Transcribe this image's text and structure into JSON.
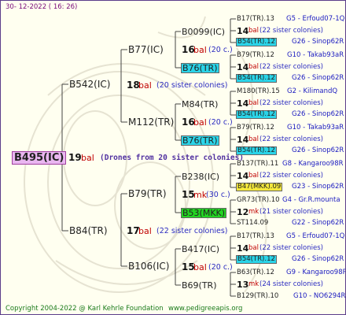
{
  "header": {
    "date": "30- 12-2022 ( 16: 26)"
  },
  "footer": {
    "copyright": "Copyright 2004-2022 @ Karl Kehrle Foundation",
    "site": "www.pedigreeapis.org"
  },
  "root": {
    "id": "B495(IC)",
    "num": "19",
    "bal": "bal",
    "note": "(Drones from 20 sister colonies)"
  },
  "g1": [
    {
      "id": "B542(IC)",
      "num": "18",
      "bal": "bal",
      "note": "(20 sister colonies)"
    },
    {
      "id": "B84(TR)",
      "num": "17",
      "bal": "bal",
      "note": "(22 sister colonies)"
    }
  ],
  "g2": [
    {
      "id": "B77(IC)",
      "num": "16",
      "bal": "bal",
      "note": "(20 c.)"
    },
    {
      "id": "M112(TR)",
      "num": "16",
      "bal": "bal",
      "note": "(20 c.)"
    },
    {
      "id": "B79(TR)",
      "num": "15",
      "bal": "mk",
      "note": "(30 c.)"
    },
    {
      "id": "B106(IC)",
      "num": "15",
      "bal": "bal",
      "note": "(20 c.)"
    }
  ],
  "g3": [
    {
      "id": "B0099(IC)"
    },
    {
      "id": "B76(TR)"
    },
    {
      "id": "M84(TR)"
    },
    {
      "id": "B76(TR)"
    },
    {
      "id": "B238(IC)"
    },
    {
      "id": "B53(MKK)"
    },
    {
      "id": "B417(IC)"
    },
    {
      "id": "B69(TR)"
    }
  ],
  "g4": [
    {
      "id": "B17(TR).13",
      "origin": "G5 - Erfoud07-1Q"
    },
    {
      "num": "14",
      "bal": "bal",
      "note": "(22 sister colonies)"
    },
    {
      "id": "B54(TR).12",
      "origin": "G26 - Sinop62R"
    },
    {
      "id": "B79(TR).12",
      "origin": "G10 - Takab93aR"
    },
    {
      "num": "14",
      "bal": "bal",
      "note": "(22 sister colonies)"
    },
    {
      "id": "B54(TR).12",
      "origin": "G26 - Sinop62R"
    },
    {
      "id": "M180(TR).15",
      "origin": "G2 - KilimandQ"
    },
    {
      "num": "14",
      "bal": "bal",
      "note": "(22 sister colonies)"
    },
    {
      "id": "B54(TR).12",
      "origin": "G26 - Sinop62R"
    },
    {
      "id": "B79(TR).12",
      "origin": "G10 - Takab93aR"
    },
    {
      "num": "14",
      "bal": "bal",
      "note": "(22 sister colonies)"
    },
    {
      "id": "B54(TR).12",
      "origin": "G26 - Sinop62R"
    },
    {
      "id": "B137(TR).11",
      "origin": "G8 - Kangaroo98R"
    },
    {
      "num": "14",
      "bal": "bal",
      "note": "(22 sister colonies)"
    },
    {
      "id": "B47(MKK).09",
      "origin": "G23 - Sinop62R"
    },
    {
      "id": "GR73(TR).10",
      "origin": "G4 - Gr.R.mounta"
    },
    {
      "num": "12",
      "bal": "mk",
      "note": "(21 sister colonies)"
    },
    {
      "id": "ST114.09",
      "origin": "G22 - Sinop62R"
    },
    {
      "id": "B17(TR).13",
      "origin": "G5 - Erfoud07-1Q"
    },
    {
      "num": "14",
      "bal": "bal",
      "note": "(22 sister colonies)"
    },
    {
      "id": "B54(TR).12",
      "origin": "G26 - Sinop62R"
    },
    {
      "id": "B63(TR).12",
      "origin": "G9 - Kangaroo98R"
    },
    {
      "num": "13",
      "bal": "mk",
      "note": "(24 sister colonies)"
    },
    {
      "id": "B129(TR).10",
      "origin": "G10 - NO6294R"
    }
  ],
  "colors": {
    "cyan": "#2ad4e8",
    "yellow": "#f4e83c",
    "green": "#22d422",
    "pink": "#e9b6f0",
    "red": "#c00000",
    "blue": "#1a1ac0"
  }
}
